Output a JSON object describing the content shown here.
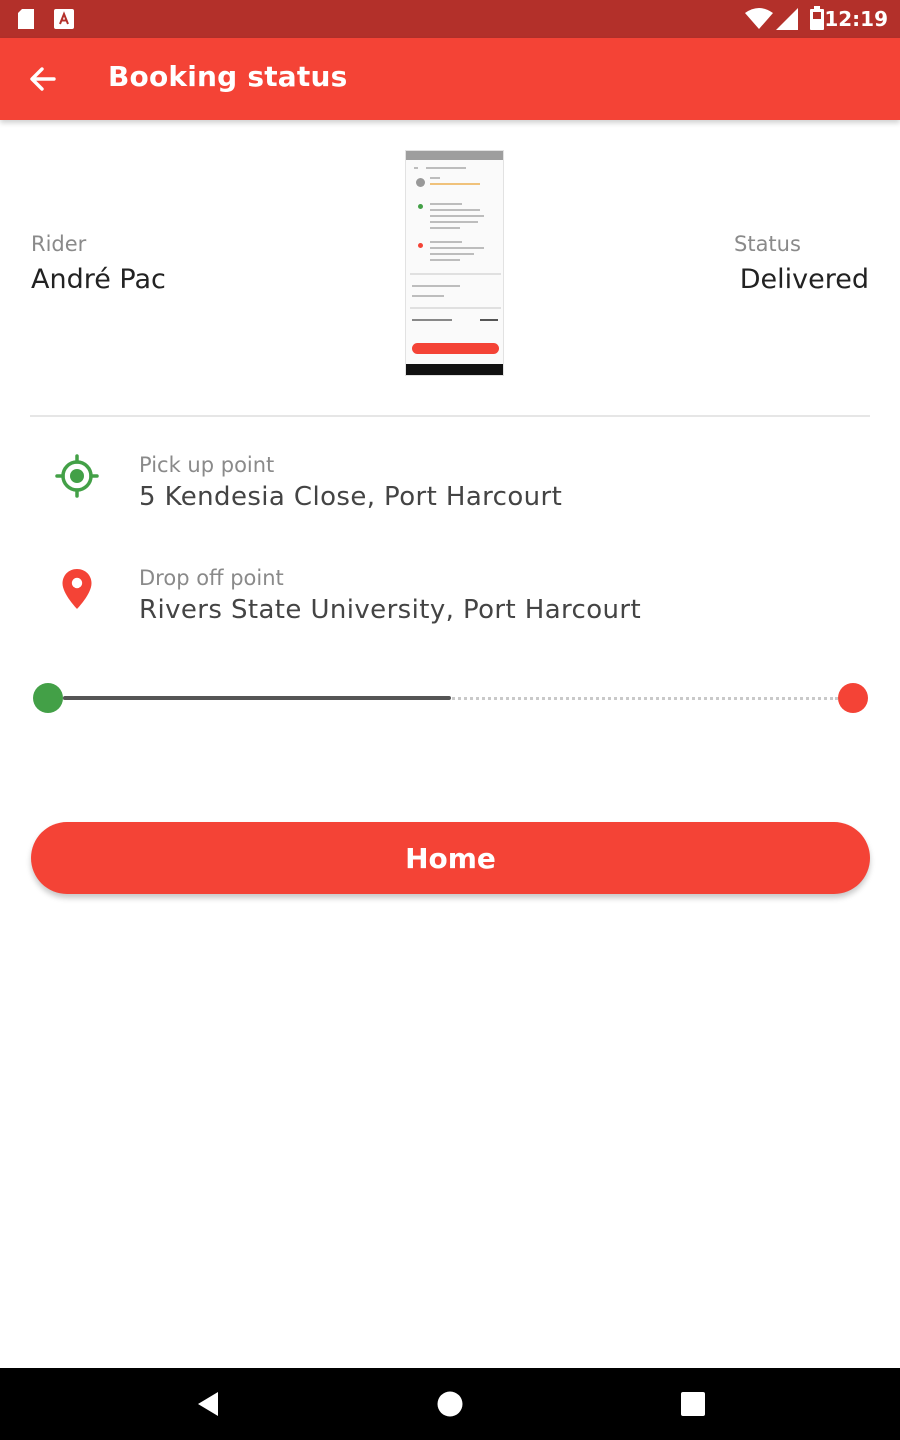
{
  "status_bar": {
    "time": "12:19",
    "icons": [
      "sd-card-icon",
      "app-notification-icon",
      "wifi-icon",
      "signal-icon",
      "battery-icon"
    ]
  },
  "app_bar": {
    "title": "Booking status",
    "back_icon": "arrow-left-icon"
  },
  "booking": {
    "rider_label": "Rider",
    "rider_name": "André Pac",
    "status_label": "Status",
    "status_value": "Delivered"
  },
  "route": {
    "pickup_label": "Pick up point",
    "pickup_address": "5 Kendesia Close, Port Harcourt",
    "pickup_icon": "target-location-icon",
    "dropoff_label": "Drop off point",
    "dropoff_address": "Rivers State University, Port Harcourt",
    "dropoff_icon": "map-pin-icon",
    "progress": 0.5
  },
  "actions": {
    "home_label": "Home"
  },
  "nav_bar": {
    "items": [
      "back-triangle-icon",
      "home-circle-icon",
      "recents-square-icon"
    ]
  },
  "colors": {
    "primary": "#f44336",
    "status_bar": "#b3302a",
    "start_marker": "#43a047",
    "end_marker": "#f44336"
  }
}
